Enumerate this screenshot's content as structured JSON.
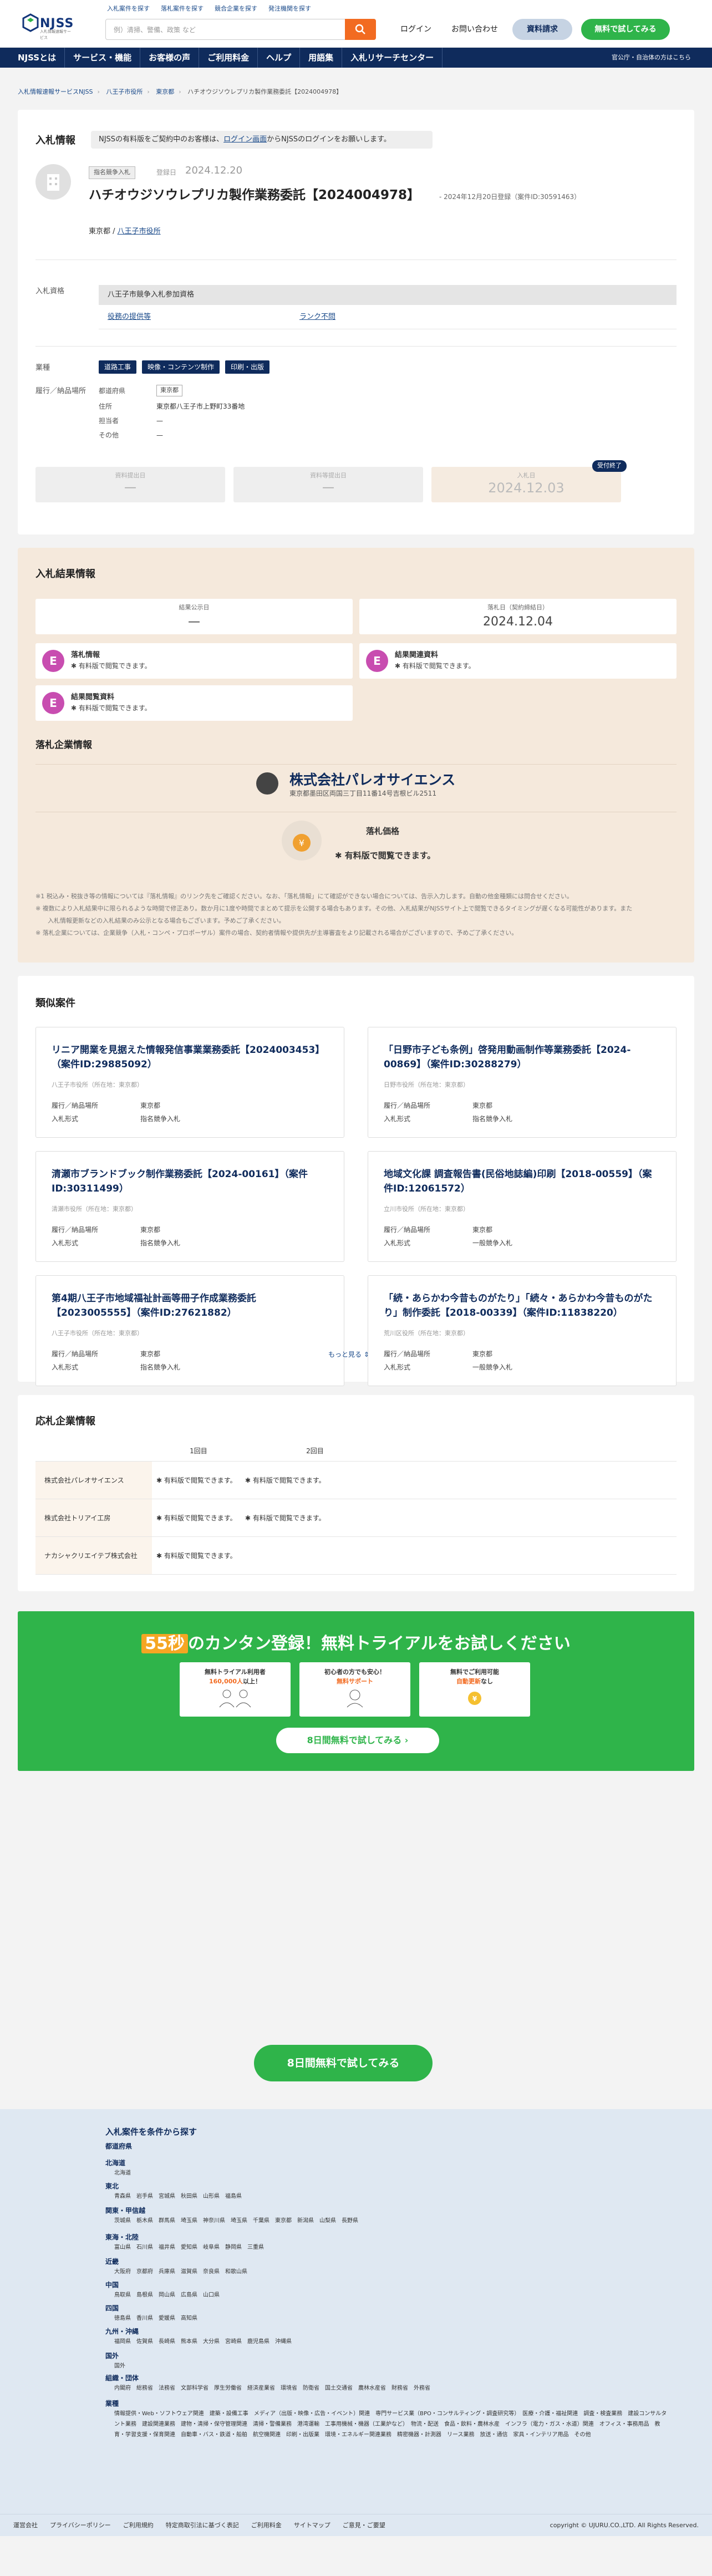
{
  "header": {
    "logo_text": "NJSS",
    "logo_sub": "入札情報速報サービス",
    "top_links": [
      "入札案件を探す",
      "落札案件を探す",
      "競合企業を探す",
      "発注機関を探す"
    ],
    "search_placeholder": "例）清掃、警備、政策 など",
    "login": "ログイン",
    "contact": "お問い合わせ",
    "docs": "資料請求",
    "trial": "無料で試してみる"
  },
  "nav": {
    "items": [
      "NJSSとは",
      "サービス・機能",
      "お客様の声",
      "ご利用料金",
      "ヘルプ",
      "用語集",
      "入札リサーチセンター"
    ],
    "right": "官公庁・自治体の方はこちら"
  },
  "breadcrumb": [
    "入札情報速報サービスNJSS",
    "八王子市役所",
    "東京都",
    "ハチオウジソウレプリカ製作業務委託【2024004978】"
  ],
  "bid": {
    "section": "入札情報",
    "notice_pre": "NJSSの有料版をご契約中のお客様は、",
    "notice_link": "ログイン画面",
    "notice_post": "からNJSSのログインをお願いします。",
    "method": "指名競争入札",
    "reg_label": "登録日",
    "reg_date": "2024.12.20",
    "title": "ハチオウジソウレプリカ製作業務委託【2024004978】",
    "sub": "- 2024年12月20日登録（案件ID:30591463）",
    "loc_pref": "東京都 /",
    "loc_org": "八王子市役所",
    "qual_label": "入札資格",
    "qual_head": "八王子市競争入札参加資格",
    "qual_link1": "役務の提供等",
    "qual_link2": "ランク不問",
    "industry_label": "業種",
    "tags": [
      "道路工事",
      "映像・コンテンツ制作",
      "印刷・出版"
    ],
    "place_label": "履行／納品場所",
    "pref_label": "都道府県",
    "pref_value": "東京都",
    "addr_label": "住所",
    "addr_value": "東京都八王子市上野町33番地",
    "person_label": "担当者",
    "person_value": "—",
    "other_label": "その他",
    "other_value": "—",
    "dates": [
      {
        "label": "資料提出日",
        "value": "—"
      },
      {
        "label": "資料等提出日",
        "value": "—"
      },
      {
        "label": "入札日",
        "value": "2024.12.03"
      }
    ],
    "received": "受付終了"
  },
  "result": {
    "section": "入札結果情報",
    "open_label": "結果公示日",
    "open_value": "—",
    "award_label": "落札日（契約締結日）",
    "award_value": "2024.12.04",
    "items": [
      {
        "title": "落札情報",
        "desc": "✱ 有料版で閲覧できます。"
      },
      {
        "title": "結果関連資料",
        "desc": "✱ 有料版で閲覧できます。"
      },
      {
        "title": "結果閲覧資料",
        "desc": "✱ 有料版で閲覧できます。"
      }
    ],
    "winner_section": "落札企業情報",
    "winner": "株式会社パレオサイエンス",
    "winner_addr": "東京都墨田区両国三丁目11番14号吉根ビル2511",
    "price_label": "落札価格",
    "price_value": "✱ 有料版で閲覧できます。",
    "notes": [
      "※1 税込み・税抜き等の情報については『落札情報』のリンク先をご確認ください。なお、「落札情報」にて確認ができない場合については、告示入力します。自動の他金種類には問合せください。",
      "※ 複数により入札結果中に限られるような時間で修正あり。数か月に1度や時間でまとめて提示を公開する場合もあります。その他、入札結果がNJSSサイト上で閲覧できるタイミングが遅くなる可能性があります。また",
      "　　入札情報更新などの入札結果のみ公示となる場合もございます。予めご了承ください。",
      "※ 落札企業については、企業競争（入札・コンペ・プロポーザル）案件の場合、契約者情報や提供先が主導審査をより記載される場合がございますので、予めご了承ください。"
    ]
  },
  "similar": {
    "section": "類似案件",
    "cards": [
      {
        "title": "リニア開業を見据えた情報発信事業業務委託【2024003453】（案件ID:29885092）",
        "org": "八王子市役所（所在地：東京都）",
        "place": "東京都",
        "method": "指名競争入札"
      },
      {
        "title": "「日野市子ども条例」啓発用動画制作等業務委託【2024-00869】（案件ID:30288279）",
        "org": "日野市役所（所在地：東京都）",
        "place": "東京都",
        "method": "指名競争入札"
      },
      {
        "title": "清瀬市ブランドブック制作業務委託【2024-00161】（案件ID:30311499）",
        "org": "清瀬市役所（所在地：東京都）",
        "place": "東京都",
        "method": "指名競争入札"
      },
      {
        "title": "地域文化課 調査報告書(民俗地誌編)印刷【2018-00559】（案件ID:12061572）",
        "org": "立川市役所（所在地：東京都）",
        "place": "東京都",
        "method": "一般競争入札"
      },
      {
        "title": "第4期八王子市地域福祉計画等冊子作成業務委託【2023005555】（案件ID:27621882）",
        "org": "八王子市役所（所在地：東京都）",
        "place": "東京都",
        "method": "指名競争入札"
      },
      {
        "title": "「続・あらかわ今昔ものがたり」「続々・あらかわ今昔ものがたり」制作委託【2018-00339】（案件ID:11838220）",
        "org": "荒川区役所（所在地：東京都）",
        "place": "東京都",
        "method": "一般競争入札"
      }
    ],
    "place_label": "履行／納品場所",
    "method_label": "入札形式",
    "more": "もっと見る"
  },
  "bidders": {
    "section": "応札企業情報",
    "rounds": [
      "1回目",
      "2回目"
    ],
    "rows": [
      {
        "name": "株式会社パレオサイエンス",
        "r1": "✱ 有料版で閲覧できます。",
        "r2": "✱ 有料版で閲覧できます。"
      },
      {
        "name": "株式会社トリアイ工房",
        "r1": "✱ 有料版で閲覧できます。",
        "r2": "✱ 有料版で閲覧できます。"
      },
      {
        "name": "ナカシャクリエイテブ株式会社",
        "r1": "✱ 有料版で閲覧できます。",
        "r2": ""
      }
    ]
  },
  "cta": {
    "num": "55秒",
    "head": "のカンタン登録！無料トライアルをお試しください",
    "f1a": "無料トライアル利用者",
    "f1b": "160,000人",
    "f1c": "以上！",
    "f2a": "初心者の方でも安心！",
    "f2b": "無料サポート",
    "f3a": "無料でご利用可能",
    "f3b": "自動更新",
    "f3c": "なし",
    "button": "8日間無料で試してみる",
    "big_button": "8日間無料で試してみる"
  },
  "footer": {
    "title": "入札案件を条件から探す",
    "sections": [
      {
        "name": "都道府県",
        "links": ""
      },
      {
        "name": "北海道",
        "links": "北海道"
      },
      {
        "name": "東北",
        "links": "青森県　岩手県　宮城県　秋田県　山形県　福島県"
      },
      {
        "name": "関東・甲信越",
        "links": "茨城県　栃木県　群馬県　埼玉県　神奈川県　埼玉県　千葉県　東京都　新潟県　山梨県　長野県"
      },
      {
        "name": "東海・北陸",
        "links": "富山県　石川県　福井県　愛知県　岐阜県　静岡県　三重県"
      },
      {
        "name": "近畿",
        "links": "大阪府　京都府　兵庫県　滋賀県　奈良県　和歌山県"
      },
      {
        "name": "中国",
        "links": "鳥取県　島根県　岡山県　広島県　山口県"
      },
      {
        "name": "四国",
        "links": "徳島県　香川県　愛媛県　高知県"
      },
      {
        "name": "九州・沖縄",
        "links": "福岡県　佐賀県　長崎県　熊本県　大分県　宮崎県　鹿児島県　沖縄県"
      },
      {
        "name": "国外",
        "links": "国外"
      },
      {
        "name": "組織・団体",
        "links": "内閣府　総務省　法務省　文部科学省　厚生労働省　経済産業省　環境省　防衛省　国土交通省　農林水産省　財務省　外務省"
      },
      {
        "name": "業種",
        "links": "情報提供・Web・ソフトウェア関連　建築・設備工事　メディア（出版・映像・広告・イベント）関連　専門サービス業（BPO・コンサルティング・調査研究等）　医療・介護・福祉関連　調査・検査業務　建設コンサルタント業務　建設関連業務　建物・清掃・保守管理関連　清掃・警備業務　港湾運輸　工事用機械・機器（工業炉など）　物流・配送　食品・飲料・農林水産　インフラ（電力・ガス・水道）関連　オフィス・事務用品　教育・学習支援・保育関連　自動車・バス・鉄道・船舶　航空機関連　印刷・出版業　環境・エネルギー関連業務　精密機器・計測器　リース業務　放送・通信　家具・インテリア用品　その他"
      }
    ],
    "bottom": [
      "運営会社",
      "プライバシーポリシー",
      "ご利用規約",
      "特定商取引法に基づく表記",
      "ご利用料金",
      "サイトマップ",
      "ご意見・ご要望"
    ],
    "copyright": "copyright © UJURU.CO.,LTD. All Rights Reserved."
  }
}
